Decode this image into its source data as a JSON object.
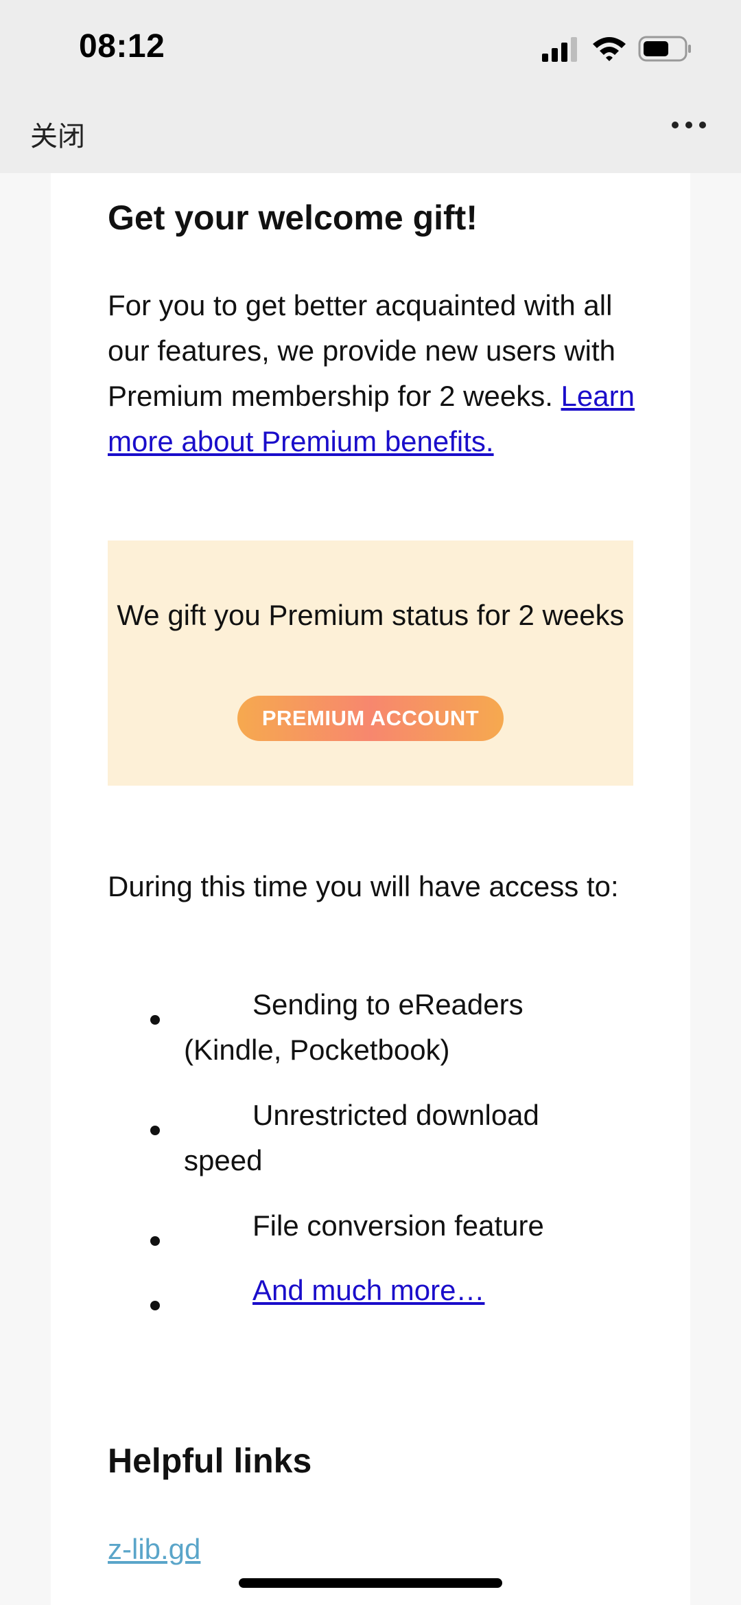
{
  "status": {
    "time": "08:12",
    "icons": [
      "signal-icon",
      "wifi-icon",
      "battery-icon"
    ]
  },
  "nav": {
    "close_label": "关闭",
    "more_icon": "more-icon"
  },
  "email": {
    "title": "Get your welcome gift!",
    "intro_text": "For you to get better acquainted with all our features, we provide new users with Premium membership for 2 weeks. ",
    "intro_link": "Learn more about Premium benefits.",
    "gift_text": "We gift you Premium status for 2 weeks",
    "premium_badge": "PREMIUM ACCOUNT",
    "access_text": "During this time you will have access to:",
    "features": [
      {
        "text": "Sending to eReaders (Kindle, Pocketbook)",
        "link": false
      },
      {
        "text": "Unrestricted download speed",
        "link": false
      },
      {
        "text": "File conversion feature",
        "link": false
      },
      {
        "text": "And much more…",
        "link": true
      }
    ],
    "links_title": "Helpful links",
    "site_link": "z-lib.gd"
  },
  "colors": {
    "link": "#1a0dca",
    "gift_bg": "#fdf0d7",
    "badge_gradient": [
      "#f6a94f",
      "#f7876e"
    ],
    "site_link": "#5aa5c9"
  }
}
